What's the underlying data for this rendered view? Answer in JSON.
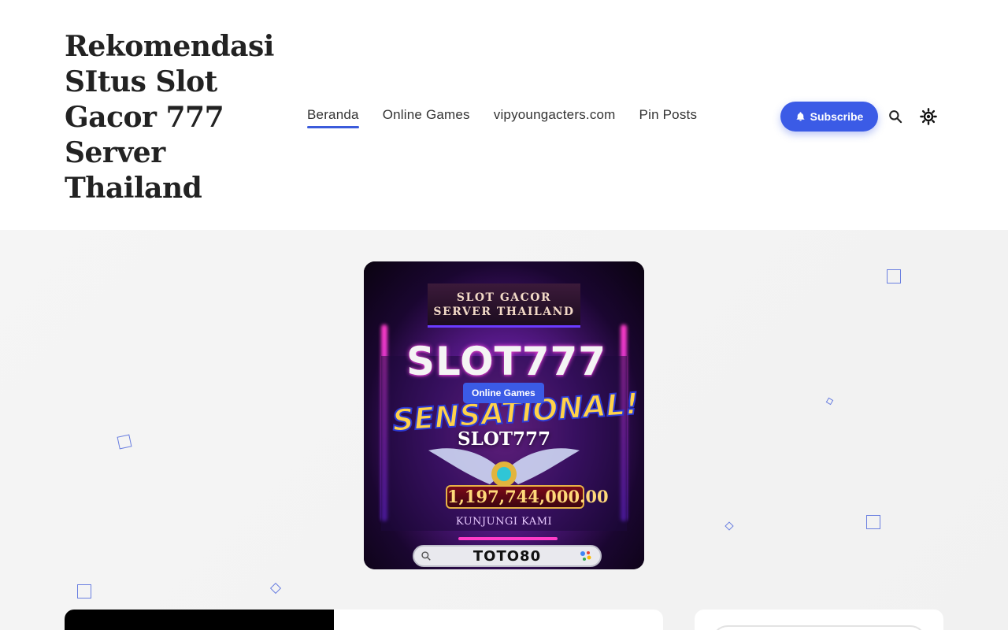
{
  "site": {
    "title_lines": [
      "Rekomendasi",
      "SItus Slot",
      "Gacor 777",
      "Server",
      "Thailand"
    ]
  },
  "nav": {
    "items": [
      {
        "label": "Beranda",
        "active": true
      },
      {
        "label": "Online Games",
        "active": false
      },
      {
        "label": "vipyoungacters.com",
        "active": false
      },
      {
        "label": "Pin Posts",
        "active": false
      }
    ]
  },
  "header_actions": {
    "subscribe_label": "Subscribe",
    "subscribe_icon": "bell-icon",
    "search_icon": "search-icon",
    "theme_icon": "sun-icon",
    "accent_color": "#3b5be6"
  },
  "featured": {
    "category": "Online Games",
    "title": "SLOT777",
    "image_text": {
      "banner": "SLOT GACOR SERVER THAILAND",
      "headline": "SLOT777",
      "subheadline": "SENSATIONAL!",
      "jackpot": "1,197,744,000.00",
      "visit": "KUNJUNGI KAMI",
      "brand": "TOTO80"
    }
  }
}
